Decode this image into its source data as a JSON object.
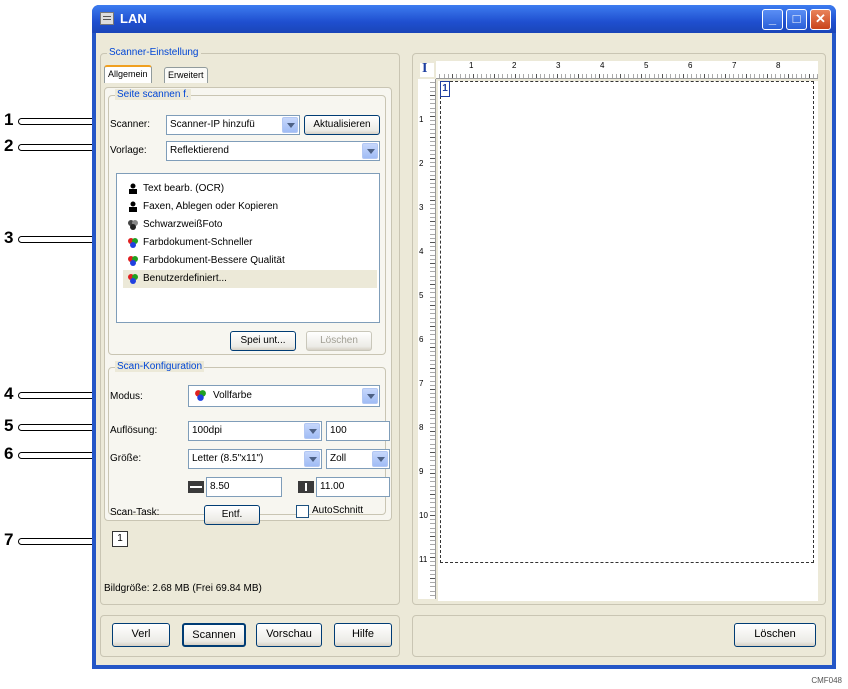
{
  "callouts": [
    "1",
    "2",
    "3",
    "4",
    "5",
    "6",
    "7"
  ],
  "window": {
    "title": "LAN"
  },
  "scanner_settings": {
    "group_label": "Scanner-Einstellung",
    "tabs": [
      {
        "label": "Allgemein",
        "active": true
      },
      {
        "label": "Erweitert",
        "active": false
      }
    ],
    "scan_page_group": "Seite scannen f.",
    "scanner_label": "Scanner:",
    "scanner_value": "Scanner-IP hinzufü",
    "refresh_button": "Aktualisieren",
    "template_label": "Vorlage:",
    "template_value": "Reflektierend",
    "presets": [
      {
        "label": "Text bearb. (OCR)",
        "icon": "bw-document-icon"
      },
      {
        "label": "Faxen, Ablegen oder Kopieren",
        "icon": "bw-document-icon"
      },
      {
        "label": "SchwarzweißFoto",
        "icon": "bw-photo-icon"
      },
      {
        "label": "Farbdokument-Schneller",
        "icon": "color-icon"
      },
      {
        "label": "Farbdokument-Bessere Qualität",
        "icon": "color-icon"
      },
      {
        "label": "Benutzerdefiniert...",
        "icon": "color-icon",
        "selected": true
      }
    ],
    "save_button": "Spei unt...",
    "delete_button": "Löschen"
  },
  "scan_config": {
    "group_label": "Scan-Konfiguration",
    "mode_label": "Modus:",
    "mode_value": "Vollfarbe",
    "resolution_label": "Auflösung:",
    "resolution_value": "100dpi",
    "resolution_number": "100",
    "size_label": "Größe:",
    "size_value": "Letter (8.5\"x11\")",
    "unit_value": "Zoll",
    "width_value": "8.50",
    "height_value": "11.00",
    "scan_task_label": "Scan-Task:",
    "remove_button": "Entf.",
    "autocrop_label": "AutoSchnitt",
    "autocrop_checked": false,
    "task_number": "1"
  },
  "status": {
    "image_size": "Bildgröße: 2.68 MB (Frei 69.84 MB)"
  },
  "ruler": {
    "h_numbers": [
      "1",
      "2",
      "3",
      "4",
      "5",
      "6",
      "7",
      "8"
    ],
    "v_numbers": [
      "1",
      "2",
      "3",
      "4",
      "5",
      "6",
      "7",
      "8",
      "9",
      "10",
      "11"
    ]
  },
  "bottom_buttons": {
    "close": "Verl",
    "scan": "Scannen",
    "preview": "Vorschau",
    "help": "Hilfe",
    "clear": "Löschen"
  },
  "image_code": "CMF048"
}
